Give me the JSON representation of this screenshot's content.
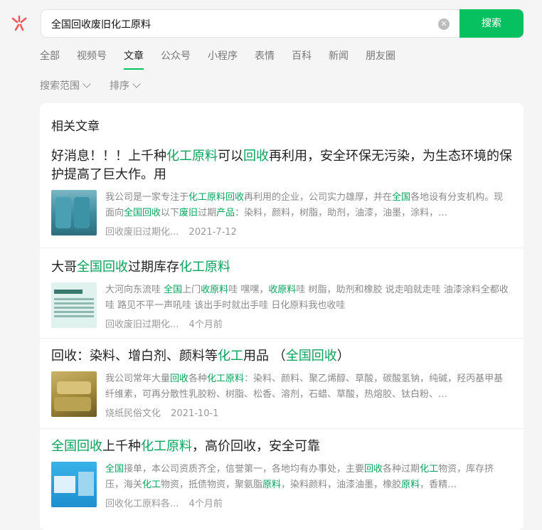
{
  "brand": {
    "logo_icon": "wechat-search-logo",
    "accent": "#07c160",
    "highlight": "#07a35c"
  },
  "search": {
    "query": "全国回收废旧化工原料",
    "button_label": "搜索",
    "clear_icon": "clear-icon"
  },
  "tabs": [
    {
      "label": "全部",
      "active": false
    },
    {
      "label": "视频号",
      "active": false
    },
    {
      "label": "文章",
      "active": true
    },
    {
      "label": "公众号",
      "active": false
    },
    {
      "label": "小程序",
      "active": false
    },
    {
      "label": "表情",
      "active": false
    },
    {
      "label": "百科",
      "active": false
    },
    {
      "label": "新闻",
      "active": false
    },
    {
      "label": "朋友圈",
      "active": false
    }
  ],
  "filters": {
    "scope_label": "搜索范围",
    "sort_label": "排序"
  },
  "section": {
    "title": "相关文章"
  },
  "articles": [
    {
      "title_parts": [
        [
          "好消息！！！上千种",
          0
        ],
        [
          "化工原料",
          1
        ],
        [
          "可以",
          0
        ],
        [
          "回收",
          1
        ],
        [
          "再利用，安全环保无污染，为生态环境的保护提高了巨大作。用",
          0
        ]
      ],
      "snippet_parts": [
        [
          "我公司是一家专注于",
          0
        ],
        [
          "化工原料回收",
          1
        ],
        [
          "再利用的企业，公司实力雄厚，并在",
          0
        ],
        [
          "全国",
          1
        ],
        [
          "各地设有分支机构。现面向",
          0
        ],
        [
          "全国回收",
          1
        ],
        [
          "以下",
          0
        ],
        [
          "废旧",
          1
        ],
        [
          "过期",
          0
        ],
        [
          "产品",
          1
        ],
        [
          "：染料，颜料，树脂，助剂，油漆，油墨，涂料，…",
          0
        ]
      ],
      "source": "回收废旧过期化...",
      "date": "2021-7-12",
      "thumb": "barrels-thumbnail"
    },
    {
      "title_parts": [
        [
          "大哥",
          0
        ],
        [
          "全国回收",
          1
        ],
        [
          "过期库存",
          0
        ],
        [
          "化工原料",
          1
        ]
      ],
      "snippet_parts": [
        [
          "大河向东流哇 ",
          0
        ],
        [
          "全国",
          1
        ],
        [
          "上门",
          0
        ],
        [
          "收原料",
          1
        ],
        [
          "哇 嘿嘿，",
          0
        ],
        [
          "收原料",
          1
        ],
        [
          "哇 树脂，助剂和橡胶 说走咱就走哇 油漆涂料全都收哇 路见不平一声吼哇 该出手时就出手哇 日化原料我也收哇",
          0
        ]
      ],
      "source": "回收废旧过期化...",
      "date": "4个月前",
      "thumb": "business-card-thumbnail"
    },
    {
      "title_parts": [
        [
          "回收：染料、增白剂、颜料等",
          0
        ],
        [
          "化工",
          1
        ],
        [
          "用品 （",
          0
        ],
        [
          "全国回收",
          1
        ],
        [
          "）",
          0
        ]
      ],
      "snippet_parts": [
        [
          "我公司常年大量",
          0
        ],
        [
          "回收",
          1
        ],
        [
          "各种",
          0
        ],
        [
          "化工原料",
          1
        ],
        [
          "：染料、颜料、聚乙烯醇、草酸，碳酸氢钠，纯碱，羟丙基甲基纤维素，可再分散性乳胶粉、树脂、松香、溶剂，石蜡、草酸，热熔胶、钛白粉、…",
          0
        ]
      ],
      "source": "烧纸民俗文化",
      "date": "2021-10-1",
      "thumb": "sacks-thumbnail"
    },
    {
      "title_parts": [
        [
          "全国回收",
          1
        ],
        [
          "上千种",
          0
        ],
        [
          "化工原料",
          1
        ],
        [
          "，高价回收，安全可靠",
          0
        ]
      ],
      "snippet_parts": [
        [
          "全国",
          1
        ],
        [
          "接单，本公司资质齐全，信誉第一，各地均有办事处，主要",
          0
        ],
        [
          "回收",
          1
        ],
        [
          "各种过期",
          0
        ],
        [
          "化工",
          1
        ],
        [
          "物资，库存挤压，海关",
          0
        ],
        [
          "化工",
          1
        ],
        [
          "物资，抵债物资，聚氨脂",
          0
        ],
        [
          "原料",
          1
        ],
        [
          "，染料颜料，油漆油墨，橡胶",
          0
        ],
        [
          "原料",
          1
        ],
        [
          "，香精…",
          0
        ]
      ],
      "source": "回收化工原料各...",
      "date": "4个月前",
      "thumb": "recycle-poster-thumbnail"
    }
  ]
}
